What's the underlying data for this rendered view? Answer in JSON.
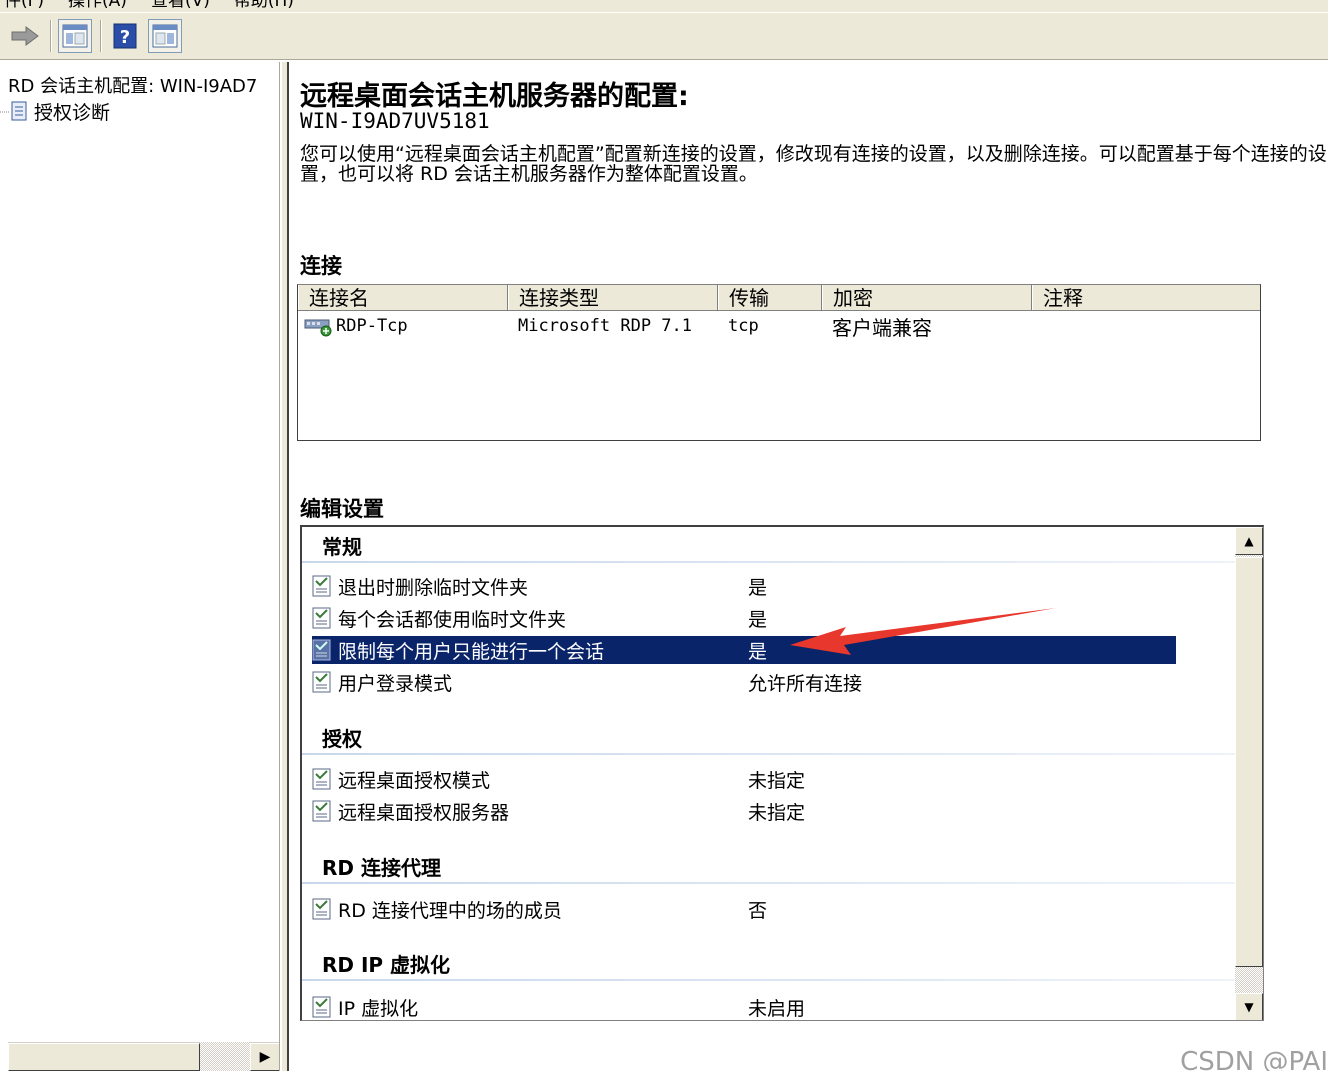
{
  "menubar": {
    "items": [
      "件(F)",
      "操作(A)",
      "查看(V)",
      "帮助(H)"
    ]
  },
  "toolbar": {
    "buttons": [
      "forward-arrow-icon",
      "show-hide-tree-icon",
      "help-icon",
      "show-hide-action-pane-icon"
    ]
  },
  "tree": {
    "root_label": "RD 会话主机配置: WIN-I9AD7",
    "child_label": "授权诊断"
  },
  "main": {
    "title": "远程桌面会话主机服务器的配置:",
    "server": "WIN-I9AD7UV5181",
    "description": "您可以使用“远程桌面会话主机配置”配置新连接的设置，修改现有连接的设置，以及删除连接。可以配置基于每个连接的设置，也可以将 RD 会话主机服务器作为整体配置设置。"
  },
  "connections": {
    "heading": "连接",
    "columns": [
      "连接名",
      "连接类型",
      "传输",
      "加密",
      "注释"
    ],
    "rows": [
      {
        "name": "RDP-Tcp",
        "type": "Microsoft RDP 7.1",
        "transport": "tcp",
        "encryption": "客户端兼容",
        "comment": ""
      }
    ]
  },
  "edit": {
    "heading": "编辑设置",
    "sections": [
      {
        "title": "常规",
        "items": [
          {
            "name": "退出时删除临时文件夹",
            "value": "是"
          },
          {
            "name": "每个会话都使用临时文件夹",
            "value": "是"
          },
          {
            "name": "限制每个用户只能进行一个会话",
            "value": "是"
          },
          {
            "name": "用户登录模式",
            "value": "允许所有连接"
          }
        ]
      },
      {
        "title": "授权",
        "items": [
          {
            "name": "远程桌面授权模式",
            "value": "未指定"
          },
          {
            "name": "远程桌面授权服务器",
            "value": "未指定"
          }
        ]
      },
      {
        "title": "RD 连接代理",
        "items": [
          {
            "name": "RD 连接代理中的场的成员",
            "value": "否"
          }
        ]
      },
      {
        "title": "RD IP 虚拟化",
        "items": [
          {
            "name": "IP 虚拟化",
            "value": "未启用"
          }
        ]
      }
    ]
  },
  "colors": {
    "selection": "#0a246a",
    "annotation_arrow": "#e8372c",
    "chrome": "#ece9d8"
  },
  "watermark": "CSDN @PAI"
}
